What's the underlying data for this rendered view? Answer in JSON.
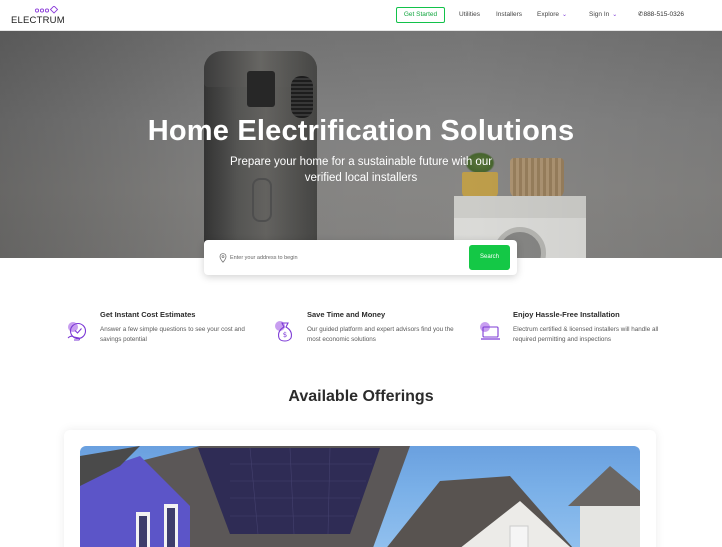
{
  "nav": {
    "logo_text": "ELECTRUM",
    "get_started": "Get Started",
    "links": [
      "Utilities",
      "Installers",
      "Explore",
      "Sign In"
    ],
    "phone": "888-515-0326"
  },
  "hero": {
    "title": "Home Electrification Solutions",
    "subtitle": "Prepare your home for a sustainable future with our verified local installers"
  },
  "search": {
    "placeholder": "Enter your address to begin",
    "button": "Search"
  },
  "features": [
    {
      "title": "Get Instant Cost Estimates",
      "desc": "Answer a few simple questions to see your cost and savings potential",
      "icon": "cost-estimate-icon"
    },
    {
      "title": "Save Time and Money",
      "desc": "Our guided platform and expert advisors find you the most economic solutions",
      "icon": "money-bag-icon"
    },
    {
      "title": "Enjoy Hassle-Free Installation",
      "desc": "Electrum certified & licensed installers will handle all required permitting and inspections",
      "icon": "laptop-icon"
    }
  ],
  "offerings": {
    "title": "Available Offerings"
  },
  "colors": {
    "accent_purple": "#7d3bd6",
    "accent_green": "#14c846"
  }
}
